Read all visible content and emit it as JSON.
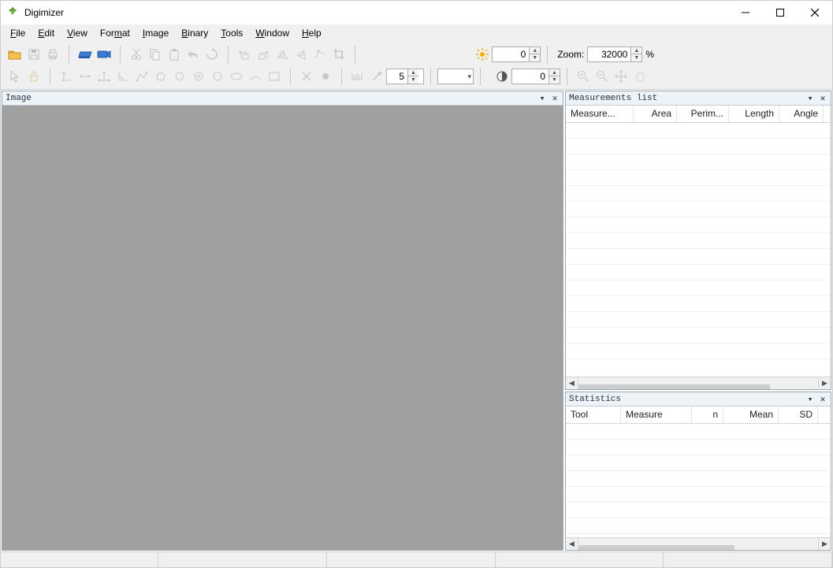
{
  "app": {
    "title": "Digimizer"
  },
  "menus": [
    "File",
    "Edit",
    "View",
    "Format",
    "Image",
    "Binary",
    "Tools",
    "Window",
    "Help"
  ],
  "menu_mnemonic_index": [
    0,
    0,
    0,
    3,
    0,
    0,
    0,
    0,
    0
  ],
  "toolbar1": {
    "brightness_value": "0",
    "zoom_label": "Zoom:",
    "zoom_value": "32000",
    "zoom_unit": "%",
    "contrast_value": "0"
  },
  "toolbar2": {
    "line_width_value": "5"
  },
  "panels": {
    "image_title": "Image",
    "measurements_title": "Measurements list",
    "statistics_title": "Statistics"
  },
  "measurements_columns": [
    "Measure...",
    "Area",
    "Perim...",
    "Length",
    "Angle"
  ],
  "statistics_columns": [
    "Tool",
    "Measure",
    "n",
    "Mean",
    "SD"
  ],
  "icons": {
    "open": "open",
    "save": "save",
    "print": "print",
    "scan": "scan",
    "camera": "camera",
    "cut": "cut",
    "copy": "copy",
    "paste": "paste",
    "undo": "undo",
    "redo": "redo",
    "rotate_ccw": "rotate-ccw",
    "rotate_cw": "rotate-cw",
    "flip_h": "flip-h",
    "flip_v": "flip-v",
    "free_rotate": "free-rotate",
    "crop": "crop",
    "brightness": "brightness",
    "contrast": "contrast",
    "zoom_in": "zoom-in",
    "zoom_out": "zoom-out",
    "fit": "fit",
    "pan": "pan",
    "pointer": "pointer",
    "lock": "lock",
    "point": "point",
    "line": "line",
    "perp": "perpendicular",
    "angle": "angle",
    "path": "path",
    "polygon": "polygon",
    "closed_spline": "closed-spline",
    "circle_center": "circle-center",
    "circle": "circle",
    "ellipse": "ellipse",
    "arc": "arc",
    "rectangle": "rectangle",
    "delete": "delete",
    "marker": "marker",
    "ruler": "ruler",
    "magic": "magic",
    "color_swatch": "color"
  }
}
